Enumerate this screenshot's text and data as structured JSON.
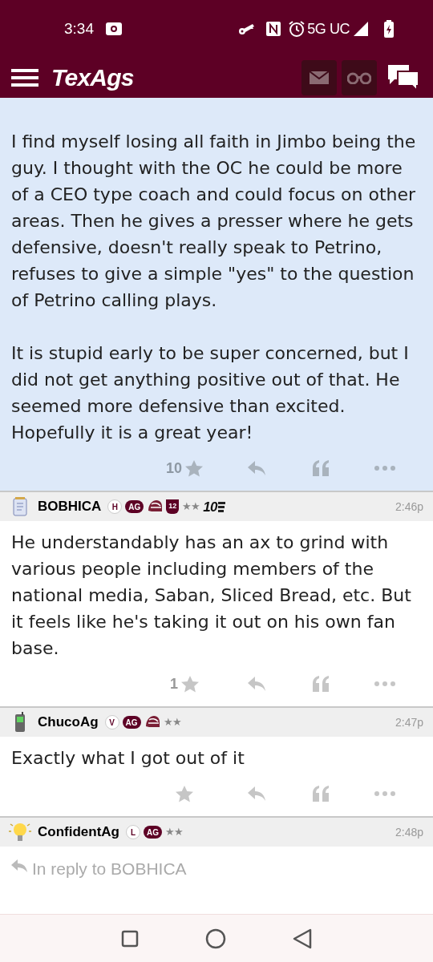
{
  "status_bar": {
    "time": "3:34",
    "network": "5G UC"
  },
  "header": {
    "logo": "TexAgs"
  },
  "posts": [
    {
      "kind": "body_only",
      "paragraphs": [
        "I find myself losing all faith in Jimbo being the guy. I thought with the OC he could be more of a CEO type coach and could focus on other areas. Then he gives a presser where he gets defensive, doesn't really speak to Petrino, refuses to give a simple \"yes\" to the question of Petrino calling plays.",
        "It is stupid early to be super concerned, but I did not get anything positive out of that. He seemed more defensive than excited. Hopefully it is a great year!"
      ],
      "likes": "10",
      "highlighted": true
    },
    {
      "kind": "full",
      "avatar": {
        "kind": "notepad"
      },
      "author": "BOBHICA",
      "badges": [
        {
          "kind": "letter",
          "text": "H"
        },
        {
          "kind": "ag",
          "text": "AG"
        },
        {
          "kind": "helmet"
        },
        {
          "kind": "shield",
          "text": "12"
        },
        {
          "kind": "stars",
          "text": "★★"
        },
        {
          "kind": "ten",
          "text": "10"
        }
      ],
      "time": "2:46p",
      "paragraphs": [
        "He understandably has an ax to grind with various people including members of the national media, Saban, Sliced Bread, etc. But it feels like he's taking it out on his own fan base."
      ],
      "likes": "1",
      "highlighted": false
    },
    {
      "kind": "full",
      "avatar": {
        "kind": "phone"
      },
      "author": "ChucoAg",
      "badges": [
        {
          "kind": "letter",
          "text": "V"
        },
        {
          "kind": "ag",
          "text": "AG"
        },
        {
          "kind": "helmet"
        },
        {
          "kind": "stars",
          "text": "★★"
        }
      ],
      "time": "2:47p",
      "paragraphs": [
        "Exactly what I got out of it"
      ],
      "highlighted": false
    },
    {
      "kind": "reply",
      "avatar": {
        "kind": "bulb"
      },
      "author": "ConfidentAg",
      "badges": [
        {
          "kind": "letter",
          "text": "L"
        },
        {
          "kind": "ag",
          "text": "AG"
        },
        {
          "kind": "stars",
          "text": "★★"
        }
      ],
      "time": "2:48p",
      "reply_to": "In reply to BOBHICA",
      "highlighted": false
    }
  ]
}
